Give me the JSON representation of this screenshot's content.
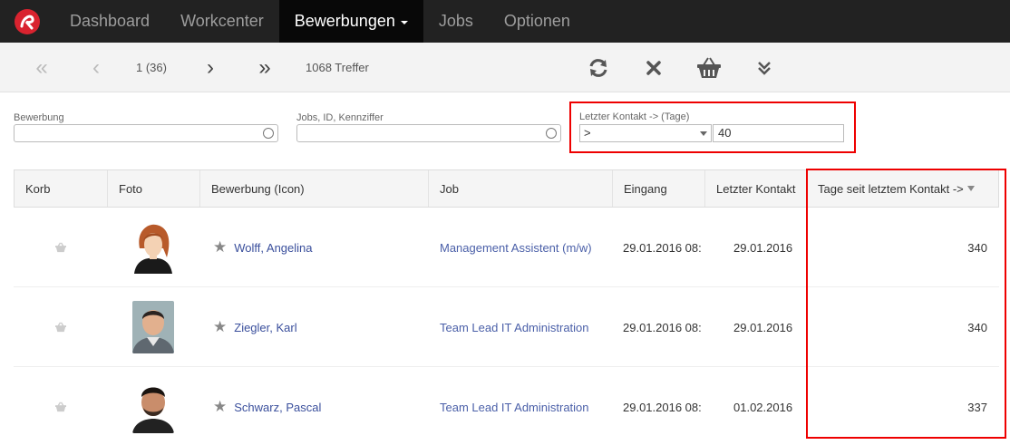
{
  "nav": {
    "items": [
      {
        "label": "Dashboard"
      },
      {
        "label": "Workcenter"
      },
      {
        "label": "Bewerbungen"
      },
      {
        "label": "Jobs"
      },
      {
        "label": "Optionen"
      }
    ],
    "active_index": 2
  },
  "toolbar": {
    "page": "1 (36)",
    "hits": "1068 Treffer",
    "icons": [
      "first-page-icon",
      "prev-page-icon",
      "next-page-icon",
      "last-page-icon",
      "refresh-icon",
      "close-icon",
      "basket-icon",
      "expand-down-icon"
    ]
  },
  "filters": {
    "bewerbung": {
      "label": "Bewerbung",
      "value": ""
    },
    "jobs": {
      "label": "Jobs, ID, Kennziffer",
      "value": ""
    },
    "letzter_kontakt": {
      "label": "Letzter Kontakt -> (Tage)",
      "operator": ">",
      "value": "40"
    }
  },
  "table": {
    "columns": [
      {
        "label": "Korb"
      },
      {
        "label": "Foto"
      },
      {
        "label": "Bewerbung (Icon)"
      },
      {
        "label": "Job"
      },
      {
        "label": "Eingang"
      },
      {
        "label": "Letzter Kontakt"
      },
      {
        "label": "Tage seit letztem Kontakt ->"
      }
    ],
    "rows": [
      {
        "name": "Wolff, Angelina",
        "job": "Management Assistent (m/w)",
        "eingang": "29.01.2016 08:",
        "letzter_kontakt": "29.01.2016",
        "tage": "340"
      },
      {
        "name": "Ziegler, Karl",
        "job": "Team Lead IT Administration",
        "eingang": "29.01.2016 08:",
        "letzter_kontakt": "29.01.2016",
        "tage": "340"
      },
      {
        "name": "Schwarz, Pascal",
        "job": "Team Lead IT Administration",
        "eingang": "29.01.2016 08:",
        "letzter_kontakt": "01.02.2016",
        "tage": "337"
      }
    ]
  },
  "colors": {
    "navbar": "#222222",
    "active_nav": "#080808",
    "link": "#3a4f9c",
    "highlight": "#e00000",
    "logo": "#d9232f"
  }
}
